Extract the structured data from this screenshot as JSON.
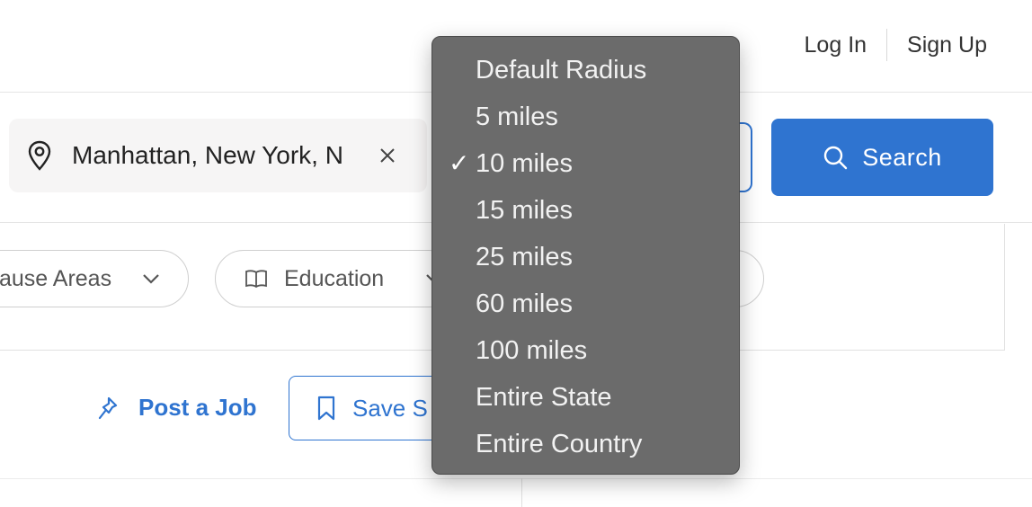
{
  "auth": {
    "login": "Log In",
    "signup": "Sign Up"
  },
  "search": {
    "location_value": "Manhattan, New York, N",
    "button_label": "Search"
  },
  "filters": {
    "cause_areas": "ause Areas",
    "education": "Education"
  },
  "actions": {
    "post_job": "Post a Job",
    "save_search": "Save S"
  },
  "radius_dropdown": {
    "selected": "10 miles",
    "options": [
      {
        "label": "Default Radius"
      },
      {
        "label": "5 miles"
      },
      {
        "label": "10 miles",
        "checked": true
      },
      {
        "label": "15 miles"
      },
      {
        "label": "25 miles"
      },
      {
        "label": "60 miles"
      },
      {
        "label": "100 miles"
      },
      {
        "label": "Entire State"
      },
      {
        "label": "Entire Country"
      }
    ]
  },
  "colors": {
    "accent": "#2f74d0",
    "menu_bg": "#6b6b6b",
    "field_bg": "#f6f5f5"
  },
  "icons": [
    "location-pin-icon",
    "close-icon",
    "search-icon",
    "chevron-down-icon",
    "book-icon",
    "pin-icon",
    "bookmark-icon",
    "checkmark-icon"
  ]
}
